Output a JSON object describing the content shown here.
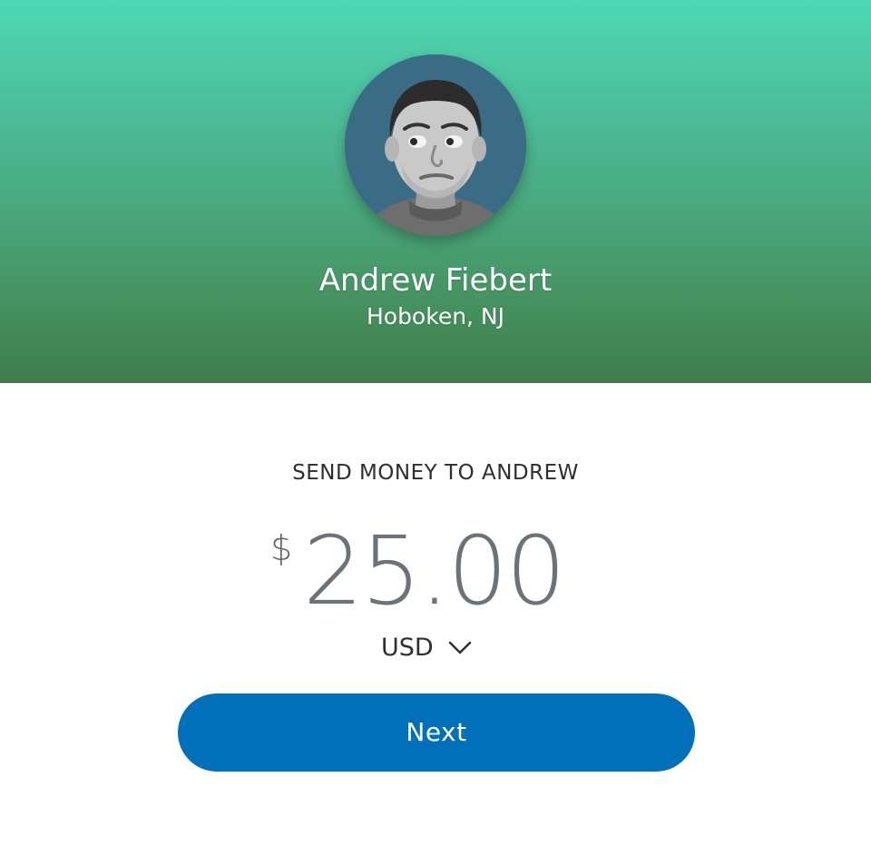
{
  "recipient": {
    "name": "Andrew Fiebert",
    "location": "Hoboken, NJ",
    "avatar_icon": "user-photo"
  },
  "send": {
    "title": "SEND MONEY TO ANDREW",
    "currency_symbol": "$",
    "amount": "25.00",
    "currency_code": "USD",
    "currency_dropdown_icon": "chevron-down-icon"
  },
  "actions": {
    "next_label": "Next"
  },
  "colors": {
    "header_gradient_top": "#4ed8b4",
    "header_gradient_bottom": "#3f7c4c",
    "button_blue": "#0070ba",
    "amount_gray": "#6c7378"
  }
}
